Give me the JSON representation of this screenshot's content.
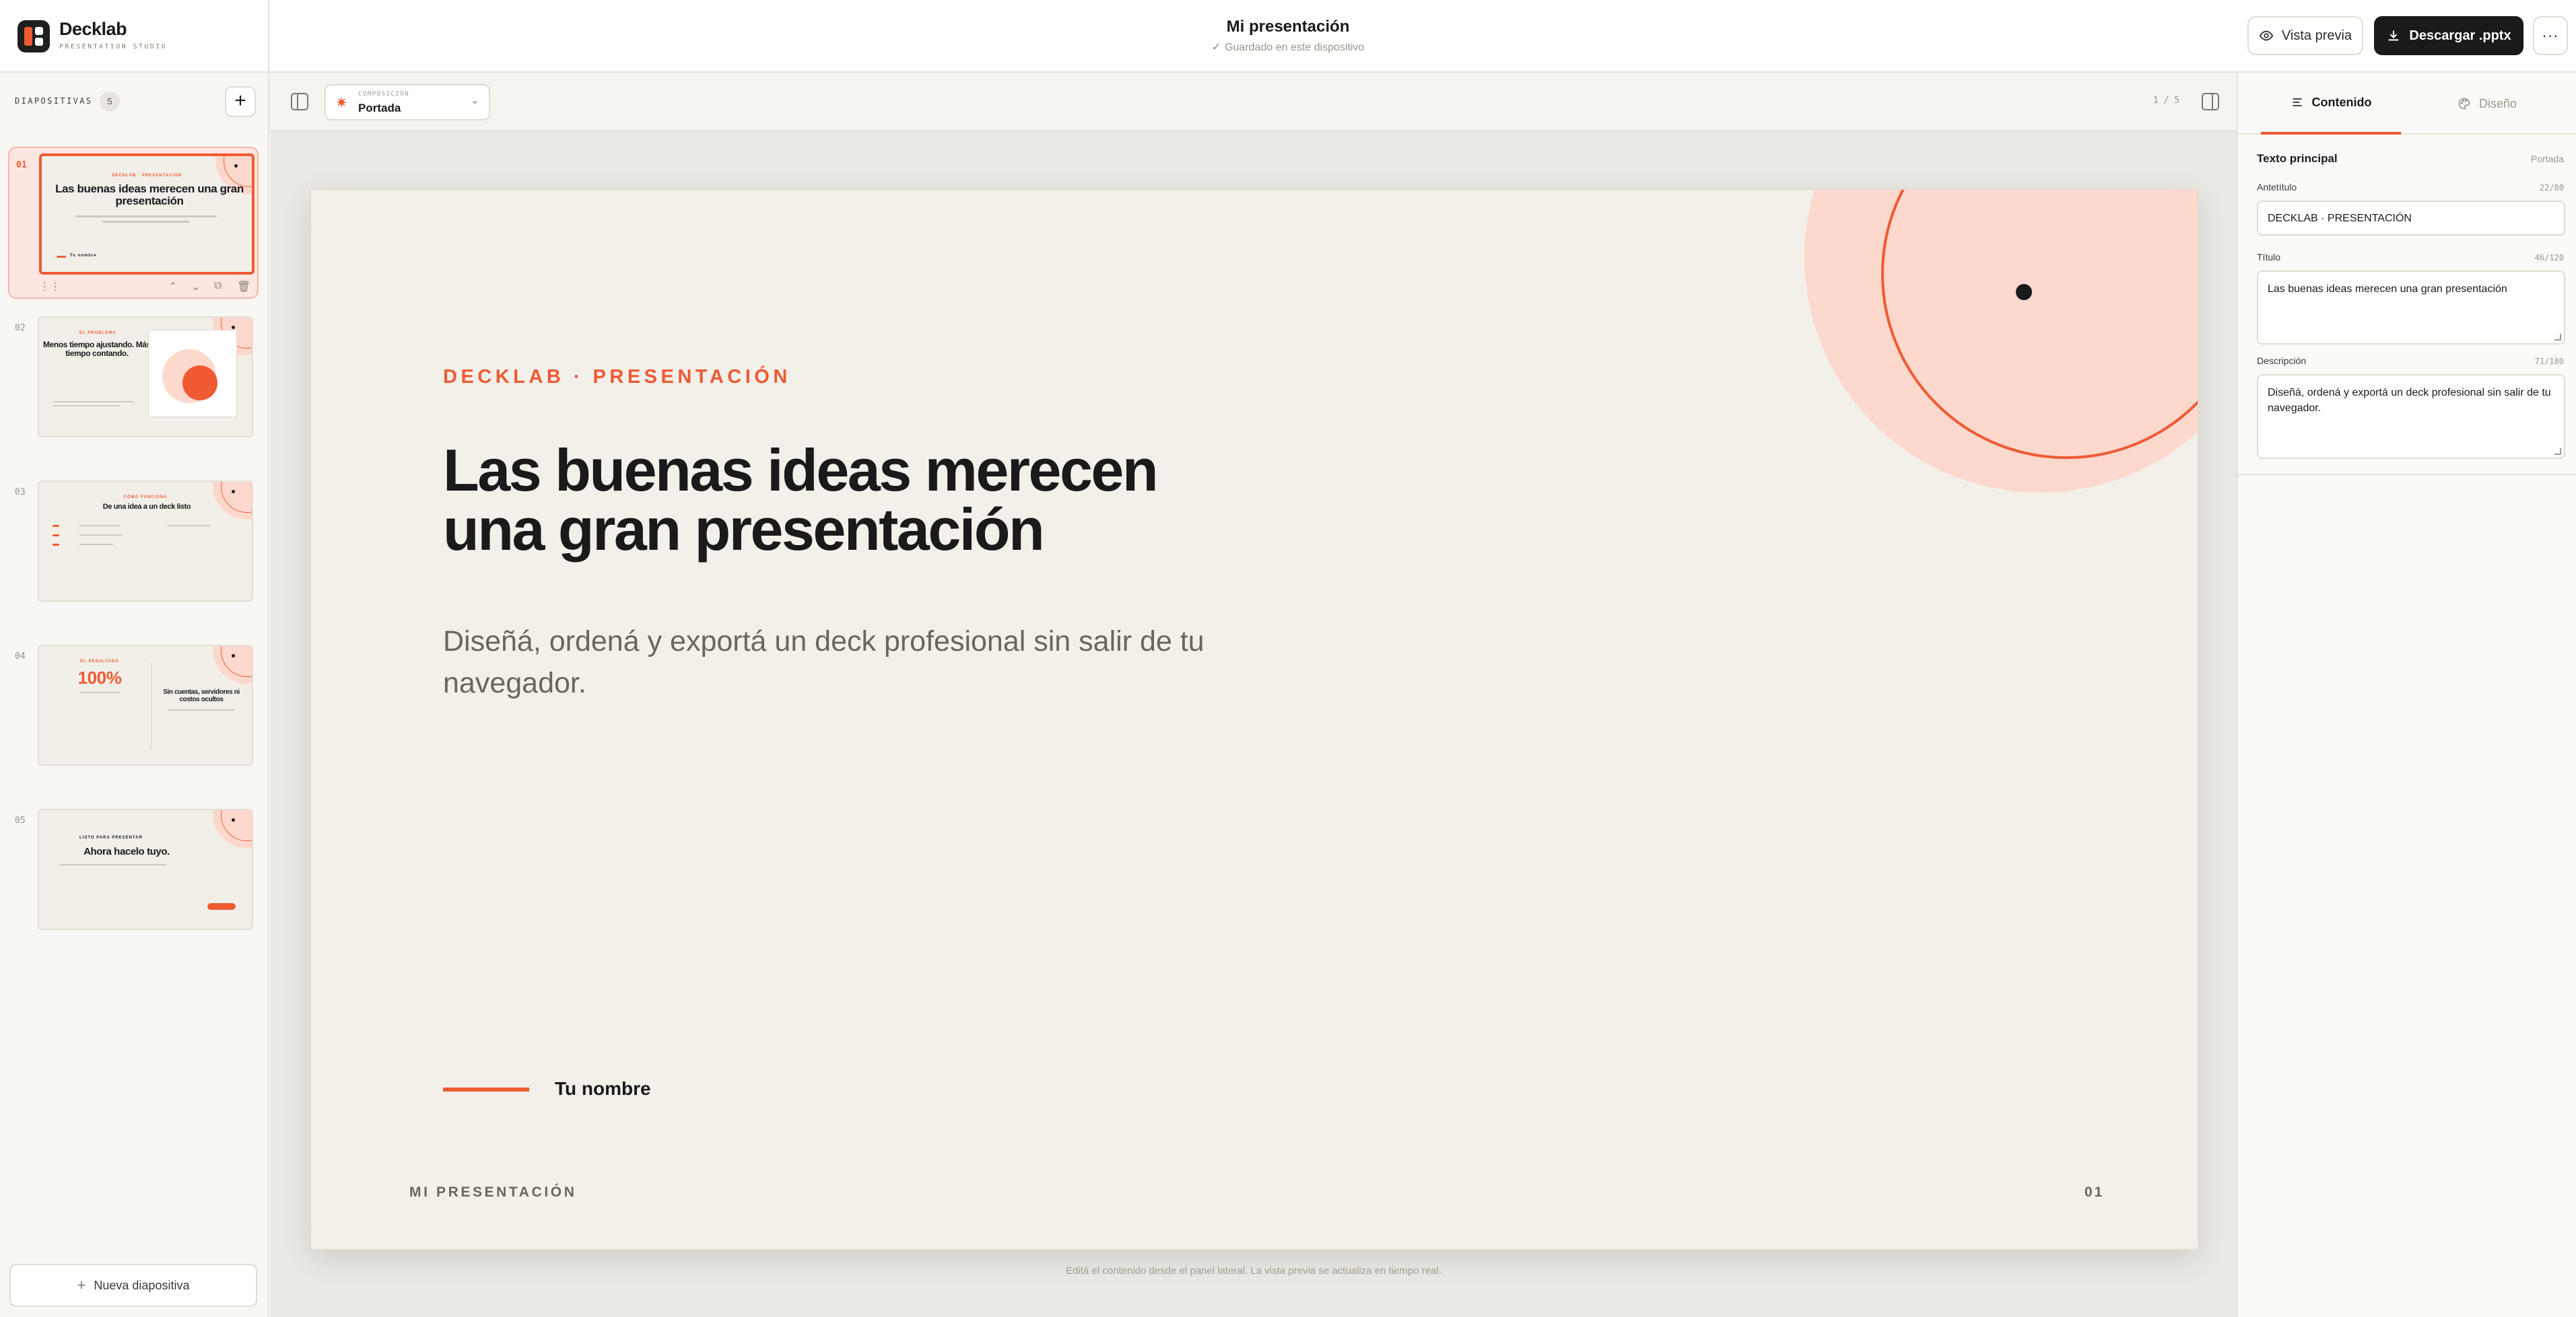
{
  "brand": {
    "name": "Decklab",
    "subtitle": "PRESENTATION STUDIO"
  },
  "header": {
    "doc_title": "Mi presentación",
    "status": "Guardado en este dispositivo",
    "preview_label": "Vista previa",
    "download_label": "Descargar .pptx",
    "more_label": "···"
  },
  "sidebar": {
    "label": "DIAPOSITIVAS",
    "count": "5",
    "new_slide_label": "Nueva diapositiva",
    "slides": [
      {
        "num": "01",
        "kicker": "DECKLAB · PRESENTACIÓN",
        "title": "Las buenas ideas merecen una gran presentación",
        "author": "Tu nombre"
      },
      {
        "num": "02",
        "kicker": "EL PROBLEMA",
        "title": "Menos tiempo ajustando. Más tiempo contando."
      },
      {
        "num": "03",
        "kicker": "CÓMO FUNCIONA",
        "title": "De una idea a un deck listo"
      },
      {
        "num": "04",
        "kicker": "EL RESULTADO",
        "title": "100%",
        "title_b": "Sin cuentas, servidores ni costos ocultos"
      },
      {
        "num": "05",
        "kicker": "LISTO PARA PRESENTAR",
        "title": "Ahora hacelo tuyo."
      }
    ]
  },
  "toolbar": {
    "layout_caption": "COMPOSICIÓN",
    "layout_value": "Portada",
    "page_counter": "1 / 5"
  },
  "slide": {
    "kicker": "DECKLAB · PRESENTACIÓN",
    "title": "Las buenas ideas merecen una gran presentación",
    "description": "Diseñá, ordená y exportá un deck profesional sin salir de tu navegador.",
    "author": "Tu nombre",
    "footer": "MI PRESENTACIÓN",
    "page": "01"
  },
  "canvas_hint": "Editá el contenido desde el panel lateral. La vista previa se actualiza en tiempo real.",
  "panel": {
    "tab_content": "Contenido",
    "tab_design": "Diseño",
    "section_title": "Texto principal",
    "section_tag": "Portada",
    "fields": [
      {
        "label": "Antetítulo",
        "count": "22/80",
        "value": "DECKLAB · PRESENTACIÓN"
      },
      {
        "label": "Título",
        "count": "46/120",
        "value": "Las buenas ideas merecen una gran presentación"
      },
      {
        "label": "Descripción",
        "count": "71/180",
        "value": "Diseñá, ordená y exportá un deck profesional sin salir de tu navegador."
      }
    ]
  },
  "colors": {
    "accent": "#ef5a33",
    "accent_soft": "#fdd8cc",
    "dark": "#1a1a1a",
    "slide_bg": "#f3f0ea"
  },
  "icons": [
    "check-icon",
    "eye-icon",
    "download-icon",
    "plus-icon",
    "sparkle-icon",
    "chevron-down-icon",
    "panel-left-icon",
    "panel-right-icon",
    "text-lines-icon",
    "palette-icon",
    "drag-handle-icon",
    "arrow-up-icon",
    "arrow-down-icon",
    "duplicate-icon",
    "trash-icon"
  ]
}
